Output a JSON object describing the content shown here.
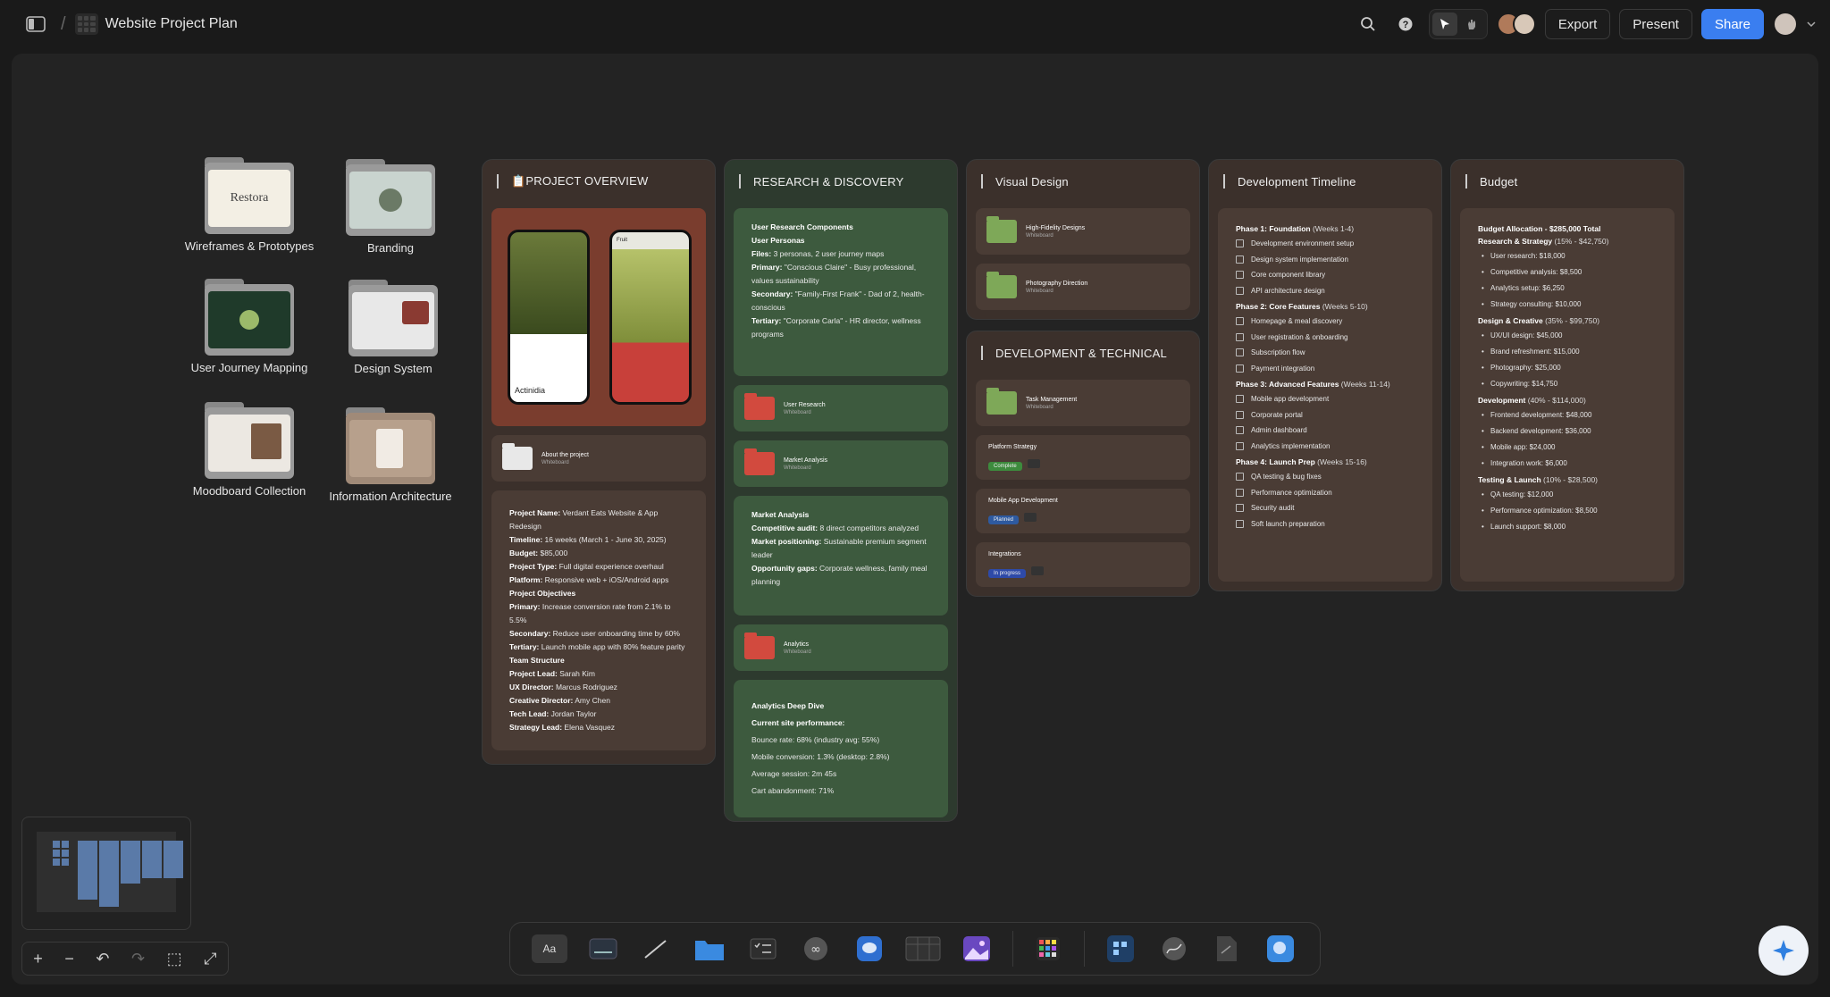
{
  "topbar": {
    "title": "Website Project Plan",
    "export_label": "Export",
    "present_label": "Present",
    "share_label": "Share",
    "breadcrumb_sep": "/"
  },
  "folders": [
    {
      "label": "Wireframes & Prototypes",
      "thumb_text": "Restora"
    },
    {
      "label": "Branding"
    },
    {
      "label": "User Journey Mapping"
    },
    {
      "label": "Design System"
    },
    {
      "label": "Moodboard Collection"
    },
    {
      "label": "Information Architecture"
    }
  ],
  "overview": {
    "title": "📋PROJECT OVERVIEW",
    "phone_left_title": "Actinidia",
    "phone_left_top": "Fruit",
    "phone_right_top": "Fruit",
    "about_title": "About the project",
    "about_sub": "Whiteboard",
    "lines": [
      {
        "b": "Project Name:",
        "t": " Verdant Eats Website & App Redesign"
      },
      {
        "b": "Timeline:",
        "t": " 16 weeks (March 1 - June 30, 2025)"
      },
      {
        "b": "Budget:",
        "t": " $85,000"
      },
      {
        "b": "Project Type:",
        "t": " Full digital experience overhaul"
      },
      {
        "b": "Platform:",
        "t": " Responsive web + iOS/Android apps"
      },
      {
        "b": "Project Objectives",
        "t": ""
      },
      {
        "b": "Primary:",
        "t": " Increase conversion rate from 2.1% to 5.5%"
      },
      {
        "b": "Secondary:",
        "t": " Reduce user onboarding time by 60%"
      },
      {
        "b": "Tertiary:",
        "t": " Launch mobile app with 80% feature parity"
      },
      {
        "b": "Team Structure",
        "t": ""
      },
      {
        "b": "Project Lead:",
        "t": " Sarah Kim"
      },
      {
        "b": "UX Director:",
        "t": " Marcus Rodriguez"
      },
      {
        "b": "Creative Director:",
        "t": " Amy Chen"
      },
      {
        "b": "Tech Lead:",
        "t": " Jordan Taylor"
      },
      {
        "b": "Strategy Lead:",
        "t": " Elena Vasquez"
      }
    ]
  },
  "research": {
    "title": "RESEARCH & DISCOVERY",
    "card1": [
      {
        "b": "User Research Components",
        "t": ""
      },
      {
        "b": "User Personas",
        "t": ""
      },
      {
        "b": "Files:",
        "t": " 3 personas, 2 user journey maps"
      },
      {
        "b": "Primary:",
        "t": " \"Conscious Claire\" - Busy professional, values sustainability"
      },
      {
        "b": "Secondary:",
        "t": " \"Family-First Frank\" - Dad of 2, health-conscious"
      },
      {
        "b": "Tertiary:",
        "t": " \"Corporate Carla\" - HR director, wellness programs"
      }
    ],
    "wb1": {
      "title": "User Research",
      "sub": "Whiteboard"
    },
    "wb2": {
      "title": "Market Analysis",
      "sub": "Whiteboard"
    },
    "card2": [
      {
        "b": "Market Analysis",
        "t": ""
      },
      {
        "b": "Competitive audit:",
        "t": " 8 direct competitors analyzed"
      },
      {
        "b": "Market positioning:",
        "t": " Sustainable premium segment leader"
      },
      {
        "b": "Opportunity gaps:",
        "t": " Corporate wellness, family meal planning"
      }
    ],
    "wb3": {
      "title": "Analytics",
      "sub": "Whiteboard"
    },
    "card3": [
      {
        "b": "Analytics Deep Dive",
        "t": ""
      },
      {
        "b": "Current site performance:",
        "t": ""
      },
      {
        "b": "",
        "t": "Bounce rate: 68% (industry avg: 55%)"
      },
      {
        "b": "",
        "t": "Mobile conversion: 1.3% (desktop: 2.8%)"
      },
      {
        "b": "",
        "t": "Average session: 2m 45s"
      },
      {
        "b": "",
        "t": "Cart abandonment: 71%"
      }
    ]
  },
  "visual": {
    "title": "Visual Design",
    "wb1": {
      "title": "High-Fidelity Designs",
      "sub": "Whiteboard"
    },
    "wb2": {
      "title": "Photography Direction",
      "sub": "Whiteboard"
    }
  },
  "devtech": {
    "title": "DEVELOPMENT & TECHNICAL",
    "wb1": {
      "title": "Task Management",
      "sub": "Whiteboard"
    },
    "items": [
      {
        "title": "Platform Strategy",
        "tag": "Complete",
        "color": "#3d8b3d"
      },
      {
        "title": "Mobile App Development",
        "tag": "Planned",
        "color": "#2e5aa0"
      },
      {
        "title": "Integrations",
        "tag": "In progress",
        "color": "#2e4aa8"
      }
    ]
  },
  "timeline": {
    "title": "Development Timeline",
    "phases": [
      {
        "name": "Phase 1: Foundation",
        "weeks": " (Weeks 1-4)",
        "items": [
          "Development environment setup",
          "Design system implementation",
          "Core component library",
          "API architecture design"
        ]
      },
      {
        "name": "Phase 2: Core Features",
        "weeks": " (Weeks 5-10)",
        "items": [
          "Homepage & meal discovery",
          "User registration & onboarding",
          "Subscription flow",
          "Payment integration"
        ]
      },
      {
        "name": "Phase 3: Advanced Features",
        "weeks": " (Weeks 11-14)",
        "items": [
          "Mobile app development",
          "Corporate portal",
          "Admin dashboard",
          "Analytics implementation"
        ]
      },
      {
        "name": "Phase 4: Launch Prep",
        "weeks": " (Weeks 15-16)",
        "items": [
          "QA testing & bug fixes",
          "Performance optimization",
          "Security audit",
          "Soft launch preparation"
        ]
      }
    ]
  },
  "budget": {
    "title": "Budget",
    "heading": "Budget Allocation - $285,000 Total",
    "groups": [
      {
        "name": "Research & Strategy",
        "pct": " (15% - $42,750)",
        "items": [
          "User research: $18,000",
          "Competitive analysis: $8,500",
          "Analytics setup: $6,250",
          "Strategy consulting: $10,000"
        ]
      },
      {
        "name": "Design & Creative",
        "pct": " (35% - $99,750)",
        "items": [
          "UX/UI design: $45,000",
          "Brand refreshment: $15,000",
          "Photography: $25,000",
          "Copywriting: $14,750"
        ]
      },
      {
        "name": "Development",
        "pct": " (40% - $114,000)",
        "items": [
          "Frontend development: $48,000",
          "Backend development: $36,000",
          "Mobile app: $24,000",
          "Integration work: $6,000"
        ]
      },
      {
        "name": "Testing & Launch",
        "pct": " (10% - $28,500)",
        "items": [
          "QA testing: $12,000",
          "Performance optimization: $8,500",
          "Launch support: $8,000"
        ]
      }
    ]
  },
  "colors": {
    "accent": "#3a7ef0",
    "brown_col": "#3b302b",
    "green_col": "#2d3a2e"
  },
  "toolbar_icons": [
    "text-icon",
    "sticky-note-icon",
    "arrow-icon",
    "folder-icon",
    "checklist-icon",
    "link-icon",
    "comment-icon",
    "table-icon",
    "image-icon",
    "apps-icon",
    "embed-icon",
    "pen-icon",
    "document-icon",
    "shape-icon"
  ]
}
